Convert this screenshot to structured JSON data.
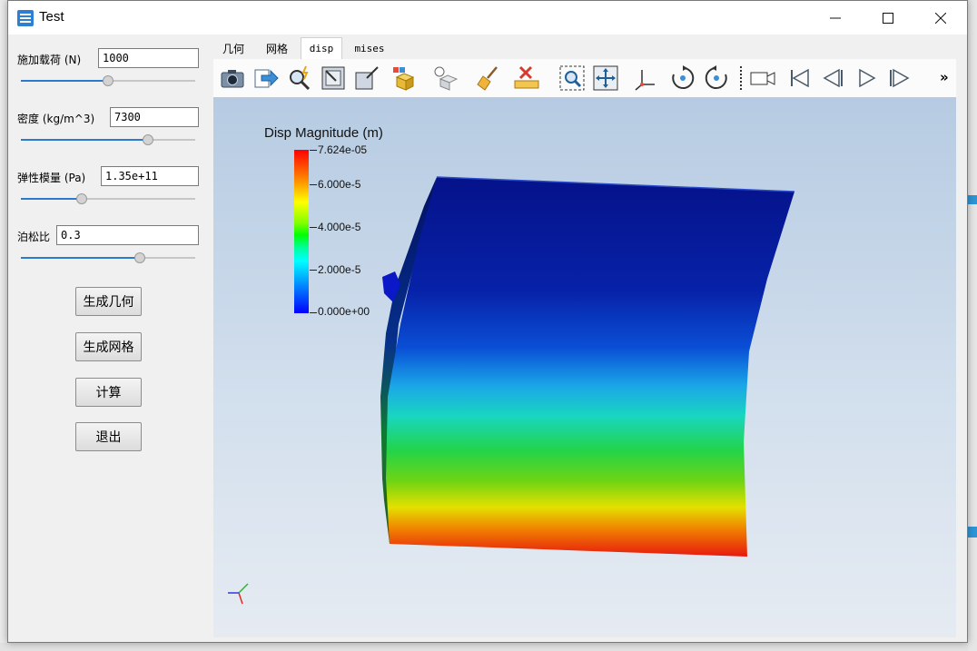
{
  "window": {
    "title": "Test"
  },
  "params": [
    {
      "label": "施加载荷 (N)",
      "value": "1000",
      "slider_pct": 50
    },
    {
      "label": "密度 (kg/m^3)",
      "value": "7300",
      "slider_pct": 73
    },
    {
      "label": "弹性模量 (Pa)",
      "value": "1.35e+11",
      "slider_pct": 35
    },
    {
      "label": "泊松比",
      "value": "0.3",
      "slider_pct": 68
    }
  ],
  "buttons": {
    "gen_geometry": "生成几何",
    "gen_mesh": "生成网格",
    "compute": "计算",
    "exit": "退出"
  },
  "tabs": [
    "几何",
    "网格",
    "disp",
    "mises"
  ],
  "active_tab": "disp",
  "toolbar": {
    "icons": [
      "camera-icon",
      "export-icon",
      "probe-icon",
      "reset-view-icon",
      "zoom-box-icon",
      "render-icon",
      "light-icon",
      "clear-icon",
      "ruler-delete-icon",
      "zoom-to-box-icon",
      "fit-all-icon",
      "axes-icon",
      "rotate-cw-icon",
      "rotate-ccw-icon",
      "camera-video-icon",
      "first-frame-icon",
      "prev-frame-icon",
      "play-icon",
      "last-frame-icon"
    ],
    "overflow": "»"
  },
  "scalar_bar": {
    "title": "Disp Magnitude (m)",
    "labels": [
      "7.624e-05",
      "6.000e-5",
      "4.000e-5",
      "2.000e-5",
      "0.000e+00"
    ]
  }
}
